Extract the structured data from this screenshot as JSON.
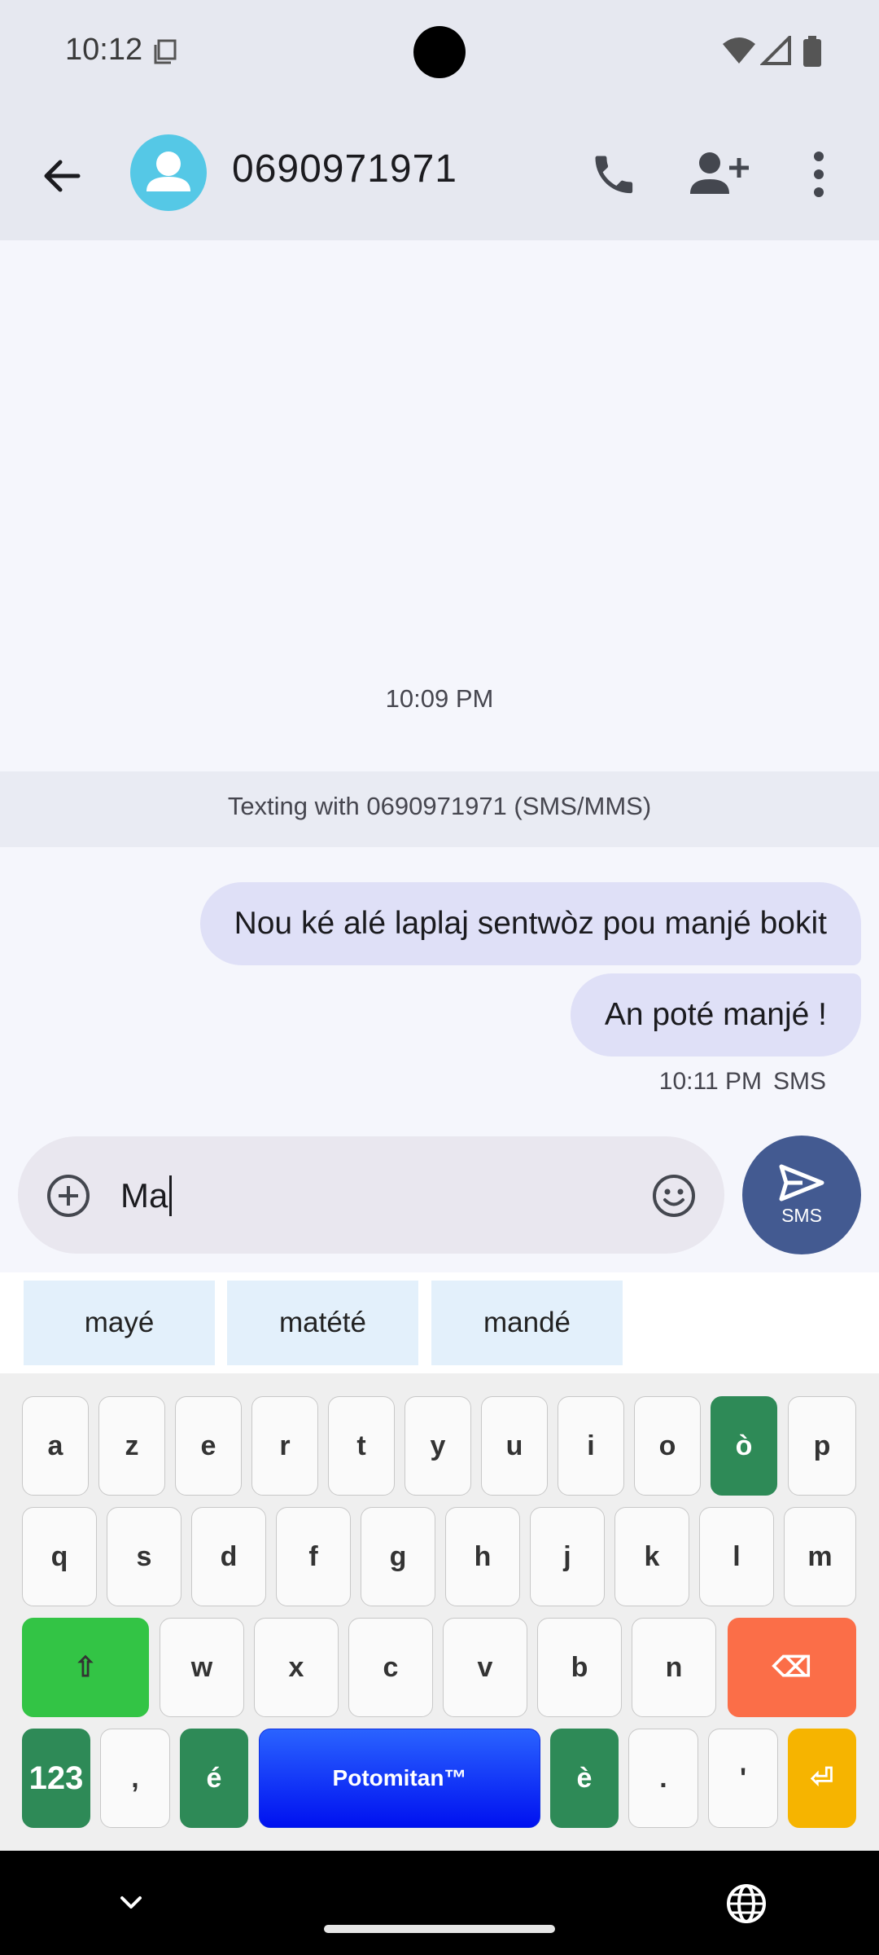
{
  "status_bar": {
    "time": "10:12"
  },
  "header": {
    "contact_name": "0690971971"
  },
  "conversation": {
    "timestamp": "10:09 PM",
    "banner": "Texting with 0690971971 (SMS/MMS)",
    "messages": [
      {
        "text": "Nou ké alé laplaj sentwòz pou manjé bokit",
        "direction": "outgoing"
      },
      {
        "text": "An poté manjé !",
        "direction": "outgoing"
      }
    ],
    "last_time": "10:11 PM",
    "last_type": "SMS"
  },
  "compose": {
    "value": "Ma",
    "send_label": "SMS"
  },
  "suggestions": [
    "mayé",
    "matété",
    "mandé"
  ],
  "keyboard": {
    "row1": [
      "a",
      "z",
      "e",
      "r",
      "t",
      "y",
      "u",
      "i",
      "o",
      "ò",
      "p"
    ],
    "row2": [
      "q",
      "s",
      "d",
      "f",
      "g",
      "h",
      "j",
      "k",
      "l",
      "m"
    ],
    "row3": [
      "⇧",
      "w",
      "x",
      "c",
      "v",
      "b",
      "n",
      "⌫"
    ],
    "row4": [
      "123",
      ",",
      "é",
      "Potomitan™",
      "è",
      ".",
      "'",
      "⏎"
    ]
  },
  "colors": {
    "accent_bubble": "#dfe0f7",
    "send_button": "#435a91",
    "key_green": "#2e8a57",
    "key_delete": "#fb6e48",
    "key_space": "#1a3cff",
    "key_enter": "#f6b400"
  },
  "icons": [
    "back-arrow-icon",
    "avatar-person-icon",
    "phone-icon",
    "add-contact-icon",
    "more-vert-icon",
    "add-circle-icon",
    "emoji-icon",
    "send-icon",
    "chevron-down-icon",
    "globe-icon"
  ]
}
